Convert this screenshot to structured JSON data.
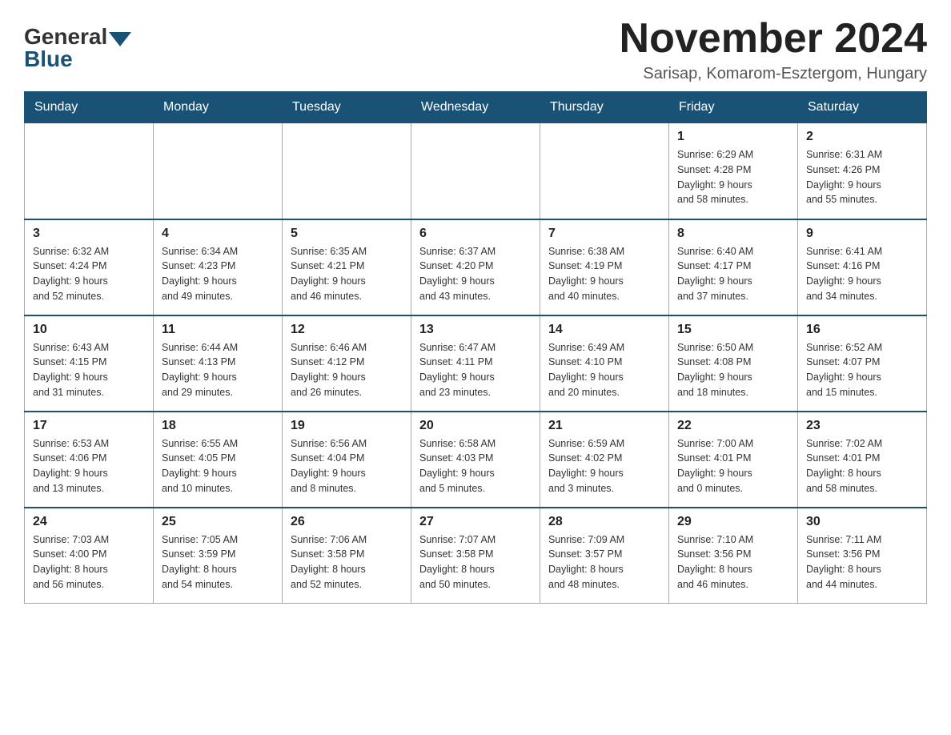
{
  "logo": {
    "general": "General",
    "blue": "Blue"
  },
  "header": {
    "month_title": "November 2024",
    "location": "Sarisap, Komarom-Esztergom, Hungary"
  },
  "weekdays": [
    "Sunday",
    "Monday",
    "Tuesday",
    "Wednesday",
    "Thursday",
    "Friday",
    "Saturday"
  ],
  "weeks": [
    [
      {
        "day": "",
        "info": ""
      },
      {
        "day": "",
        "info": ""
      },
      {
        "day": "",
        "info": ""
      },
      {
        "day": "",
        "info": ""
      },
      {
        "day": "",
        "info": ""
      },
      {
        "day": "1",
        "info": "Sunrise: 6:29 AM\nSunset: 4:28 PM\nDaylight: 9 hours\nand 58 minutes."
      },
      {
        "day": "2",
        "info": "Sunrise: 6:31 AM\nSunset: 4:26 PM\nDaylight: 9 hours\nand 55 minutes."
      }
    ],
    [
      {
        "day": "3",
        "info": "Sunrise: 6:32 AM\nSunset: 4:24 PM\nDaylight: 9 hours\nand 52 minutes."
      },
      {
        "day": "4",
        "info": "Sunrise: 6:34 AM\nSunset: 4:23 PM\nDaylight: 9 hours\nand 49 minutes."
      },
      {
        "day": "5",
        "info": "Sunrise: 6:35 AM\nSunset: 4:21 PM\nDaylight: 9 hours\nand 46 minutes."
      },
      {
        "day": "6",
        "info": "Sunrise: 6:37 AM\nSunset: 4:20 PM\nDaylight: 9 hours\nand 43 minutes."
      },
      {
        "day": "7",
        "info": "Sunrise: 6:38 AM\nSunset: 4:19 PM\nDaylight: 9 hours\nand 40 minutes."
      },
      {
        "day": "8",
        "info": "Sunrise: 6:40 AM\nSunset: 4:17 PM\nDaylight: 9 hours\nand 37 minutes."
      },
      {
        "day": "9",
        "info": "Sunrise: 6:41 AM\nSunset: 4:16 PM\nDaylight: 9 hours\nand 34 minutes."
      }
    ],
    [
      {
        "day": "10",
        "info": "Sunrise: 6:43 AM\nSunset: 4:15 PM\nDaylight: 9 hours\nand 31 minutes."
      },
      {
        "day": "11",
        "info": "Sunrise: 6:44 AM\nSunset: 4:13 PM\nDaylight: 9 hours\nand 29 minutes."
      },
      {
        "day": "12",
        "info": "Sunrise: 6:46 AM\nSunset: 4:12 PM\nDaylight: 9 hours\nand 26 minutes."
      },
      {
        "day": "13",
        "info": "Sunrise: 6:47 AM\nSunset: 4:11 PM\nDaylight: 9 hours\nand 23 minutes."
      },
      {
        "day": "14",
        "info": "Sunrise: 6:49 AM\nSunset: 4:10 PM\nDaylight: 9 hours\nand 20 minutes."
      },
      {
        "day": "15",
        "info": "Sunrise: 6:50 AM\nSunset: 4:08 PM\nDaylight: 9 hours\nand 18 minutes."
      },
      {
        "day": "16",
        "info": "Sunrise: 6:52 AM\nSunset: 4:07 PM\nDaylight: 9 hours\nand 15 minutes."
      }
    ],
    [
      {
        "day": "17",
        "info": "Sunrise: 6:53 AM\nSunset: 4:06 PM\nDaylight: 9 hours\nand 13 minutes."
      },
      {
        "day": "18",
        "info": "Sunrise: 6:55 AM\nSunset: 4:05 PM\nDaylight: 9 hours\nand 10 minutes."
      },
      {
        "day": "19",
        "info": "Sunrise: 6:56 AM\nSunset: 4:04 PM\nDaylight: 9 hours\nand 8 minutes."
      },
      {
        "day": "20",
        "info": "Sunrise: 6:58 AM\nSunset: 4:03 PM\nDaylight: 9 hours\nand 5 minutes."
      },
      {
        "day": "21",
        "info": "Sunrise: 6:59 AM\nSunset: 4:02 PM\nDaylight: 9 hours\nand 3 minutes."
      },
      {
        "day": "22",
        "info": "Sunrise: 7:00 AM\nSunset: 4:01 PM\nDaylight: 9 hours\nand 0 minutes."
      },
      {
        "day": "23",
        "info": "Sunrise: 7:02 AM\nSunset: 4:01 PM\nDaylight: 8 hours\nand 58 minutes."
      }
    ],
    [
      {
        "day": "24",
        "info": "Sunrise: 7:03 AM\nSunset: 4:00 PM\nDaylight: 8 hours\nand 56 minutes."
      },
      {
        "day": "25",
        "info": "Sunrise: 7:05 AM\nSunset: 3:59 PM\nDaylight: 8 hours\nand 54 minutes."
      },
      {
        "day": "26",
        "info": "Sunrise: 7:06 AM\nSunset: 3:58 PM\nDaylight: 8 hours\nand 52 minutes."
      },
      {
        "day": "27",
        "info": "Sunrise: 7:07 AM\nSunset: 3:58 PM\nDaylight: 8 hours\nand 50 minutes."
      },
      {
        "day": "28",
        "info": "Sunrise: 7:09 AM\nSunset: 3:57 PM\nDaylight: 8 hours\nand 48 minutes."
      },
      {
        "day": "29",
        "info": "Sunrise: 7:10 AM\nSunset: 3:56 PM\nDaylight: 8 hours\nand 46 minutes."
      },
      {
        "day": "30",
        "info": "Sunrise: 7:11 AM\nSunset: 3:56 PM\nDaylight: 8 hours\nand 44 minutes."
      }
    ]
  ]
}
